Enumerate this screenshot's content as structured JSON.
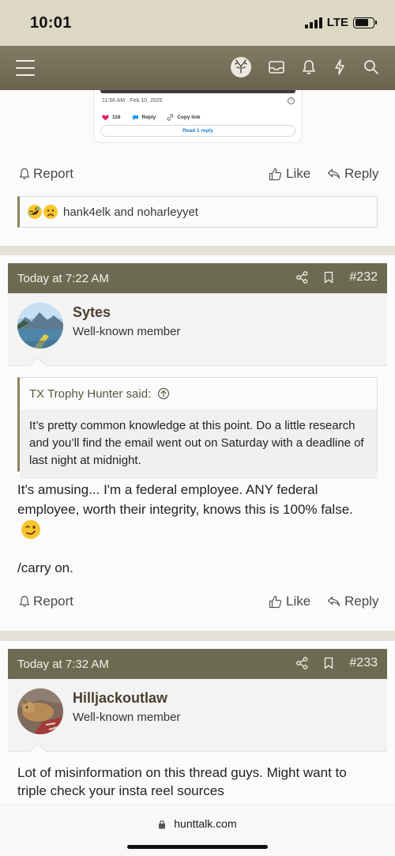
{
  "status_bar": {
    "time": "10:01",
    "network": "LTE",
    "battery_level": 0.7
  },
  "nav": {
    "icons": [
      "menu-icon",
      "site-logo-icon",
      "inbox-icon",
      "alerts-bell-icon",
      "whats-new-bolt-icon",
      "search-icon"
    ]
  },
  "colors": {
    "header_bg": "#6c6b52",
    "nav_bg": "#6b624e",
    "page_bg": "#e4e2d6",
    "username": "#4a3e2f",
    "like_heart": "#e0245e",
    "reply_bubble": "#1d9bf0",
    "link_blue": "#1d7bd8"
  },
  "embed": {
    "timestamp": "11:56 AM · Feb 10, 2025",
    "likes": "116",
    "reply_label": "Reply",
    "copy_label": "Copy link",
    "read_replies": "Read 1 reply"
  },
  "post1_actions": {
    "report": "Report",
    "like": "Like",
    "reply": "Reply"
  },
  "reactions": {
    "text": "hank4elk and noharleyyet",
    "emojis": [
      "rofl",
      "sad"
    ]
  },
  "post232": {
    "date": "Today at 7:22 AM",
    "number": "#232",
    "username": "Sytes",
    "user_title": "Well-known member",
    "quote_author": "TX Trophy Hunter said:",
    "quote_text": "It’s pretty common knowledge at this point. Do a little research and you’ll find the email went out on Saturday with a deadline of last night at midnight.",
    "message_line1": "It's amusing... I'm a federal employee. ANY federal employee, worth their integrity, knows this is 100% false.",
    "message_line2": "/carry on.",
    "report": "Report",
    "like": "Like",
    "reply": "Reply"
  },
  "post233": {
    "date": "Today at 7:32 AM",
    "number": "#233",
    "username": "Hilljackoutlaw",
    "user_title": "Well-known member",
    "message": "Lot of misinformation on this thread guys. Might want to triple check your insta reel sources"
  },
  "browser": {
    "url": "hunttalk.com"
  }
}
